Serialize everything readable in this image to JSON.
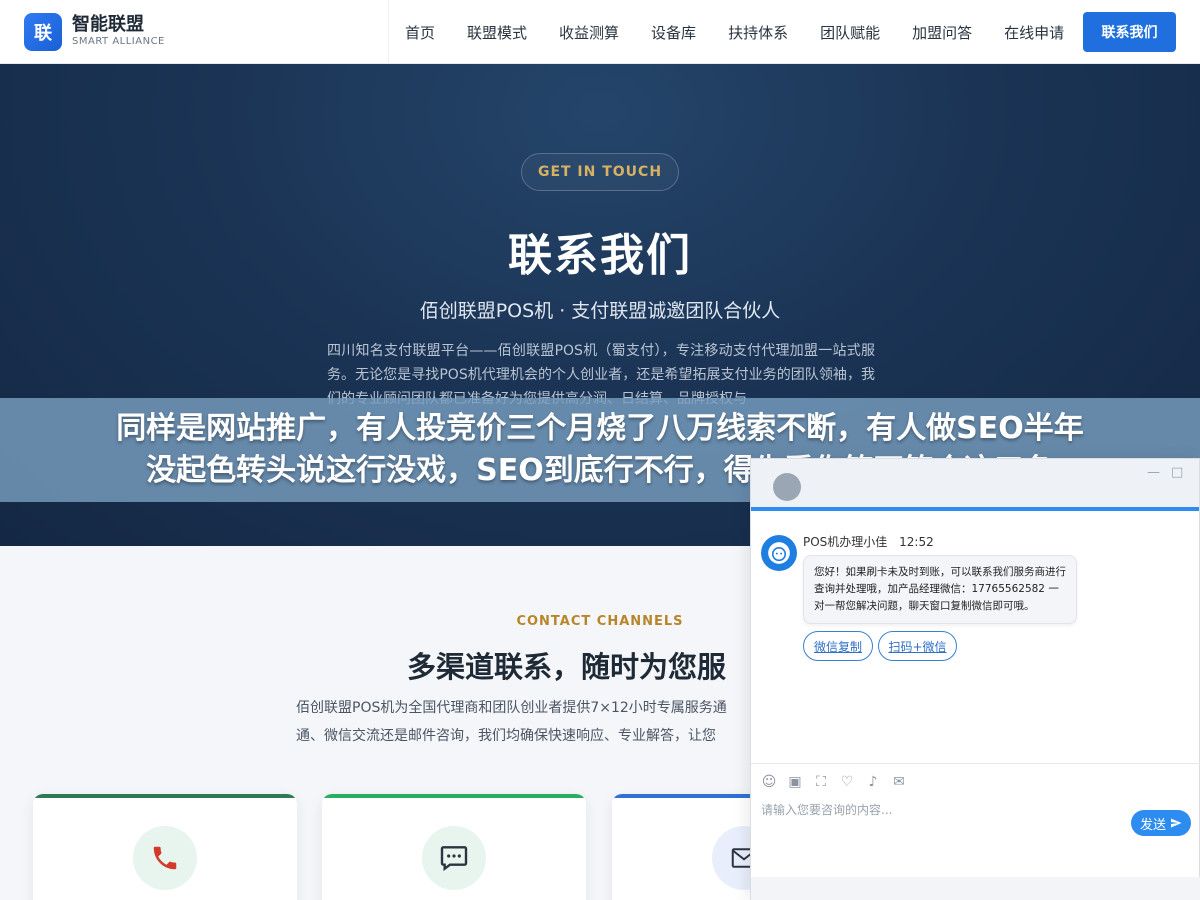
{
  "header": {
    "logo_mark": "联",
    "logo_title": "智能联盟",
    "logo_subtitle": "SMART ALLIANCE",
    "nav": [
      "首页",
      "联盟模式",
      "收益测算",
      "设备库",
      "扶持体系",
      "团队赋能",
      "加盟问答",
      "在线申请"
    ],
    "cta_label": "联系我们",
    "accent_color": "#1f6fde"
  },
  "hero": {
    "pill_label": "GET IN TOUCH",
    "title": "联系我们",
    "subtitle": "佰创联盟POS机 · 支付联盟诚邀团队合伙人",
    "description": "四川知名支付联盟平台——佰创联盟POS机（蜀支付），专注移动支付代理加盟一站式服务。无论您是寻找POS机代理机会的个人创业者，还是希望拓展支付业务的团队领袖，我们的专业顾问团队都已准备好为您提供高分润、日结算、品牌授权与"
  },
  "banner": {
    "line1": "同样是网站推广，有人投竞价三个月烧了八万线索不断，有人做SEO半年",
    "line2": "没起色转头说这行没戏，SEO到底行不行，得先看你符不符合这三条"
  },
  "channels": {
    "kicker": "CONTACT CHANNELS",
    "title": "多渠道联系，随时为您服",
    "desc_line1": "佰创联盟POS机为全国代理商和团队创业者提供7×12小时专属服务通",
    "desc_line2": "通、微信交流还是邮件咨询，我们均确保快速响应、专业解答，让您"
  },
  "cards": [
    {
      "name": "phone",
      "bar_color": "#2e9e6a",
      "icon_bg": "#e7f5ee",
      "icon_color": "#d23a2a"
    },
    {
      "name": "message",
      "bar_color": "#27ae60",
      "icon_bg": "#e7f5ee",
      "icon_color": "#2c3440"
    },
    {
      "name": "mail",
      "bar_color": "#2f6fd6",
      "icon_bg": "#e8eefb",
      "icon_color": "#2c3440"
    }
  ],
  "chat": {
    "agent_name": "POS机办理小佳",
    "time": "12:52",
    "message": "您好！如果刷卡未及时到账，可以联系我们服务商进行查询并处理哦，加产品经理微信：17765562582 一对一帮您解决问题，聊天窗口复制微信即可哦。",
    "btn_copy_wechat": "微信复制",
    "btn_scan_wechat": "扫码+微信",
    "input_placeholder": "请输入您要咨询的内容...",
    "send_label": "发送",
    "minimize_glyph": "—",
    "maximize_glyph": "□",
    "tools": [
      "emoji-icon",
      "image-icon",
      "screenshot-icon",
      "rate-icon",
      "voice-icon",
      "wechat-icon"
    ]
  }
}
